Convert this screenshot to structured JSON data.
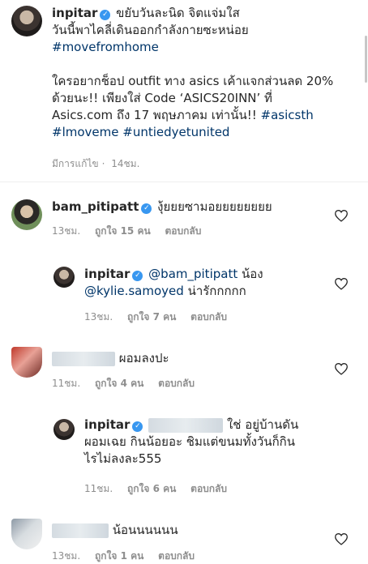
{
  "caption": {
    "username": "inpitar",
    "line1": "ขยับวันละนิด จิตแจ่มใส",
    "line2": "วันนี้พาไคลี่เดินออกกำลังกายซะหน่อย",
    "hashtag1": "#movefromhome",
    "para2_line1": "ใครอยากช็อป outfit ทาง asics เค้าแจกส่วนลด 20%",
    "para2_line2": "ด้วยนะ!! เพียงใส่ Code ‘ASICS20INN’ ที่",
    "para2_line3_text": "Asics.com ถึง 17 พฤษภาคม เท่านั้น!!",
    "hashtag2": "#asicsth",
    "hashtag3": "#lmoveme",
    "hashtag4": "#untiedyetunited",
    "edited": "มีการแก้ไข",
    "time": "14ชม."
  },
  "comments": [
    {
      "username": "bam_pitipatt",
      "text": "งุ้ยยยซามอยยยยยยยย",
      "time": "13ชม.",
      "likes": "ถูกใจ 15 คน",
      "reply": "ตอบกลับ"
    },
    {
      "username": "inpitar",
      "mention1": "@bam_pitipatt",
      "text1": "น้อง",
      "mention2": "@kylie.samoyed",
      "text2": "น่ารักกกกก",
      "time": "13ชม.",
      "likes": "ถูกใจ 7 คน",
      "reply": "ตอบกลับ"
    },
    {
      "text": "ผอมลงปะ",
      "time": "11ชม.",
      "likes": "ถูกใจ 4 คน",
      "reply": "ตอบกลับ"
    },
    {
      "username": "inpitar",
      "text_line1": "ใช่ อยู่บ้านดัน",
      "text_line2": "ผอมเฉย กินน้อยอะ ชิมแต่ขนมทั้งวันก็กิน",
      "text_line3": "ไรไม่ลงละ555",
      "time": "11ชม.",
      "likes": "ถูกใจ 6 คน",
      "reply": "ตอบกลับ"
    },
    {
      "text": "น้อนนนนนน",
      "time": "13ชม.",
      "likes": "ถูกใจ 1 คน",
      "reply": "ตอบกลับ"
    }
  ],
  "icons": {
    "verified": "verified-badge-icon",
    "heart": "heart-outline-icon",
    "verified_glyph": "✓"
  },
  "colors": {
    "link": "#003569",
    "verified": "#3897f0",
    "meta": "#8e8e8e"
  }
}
